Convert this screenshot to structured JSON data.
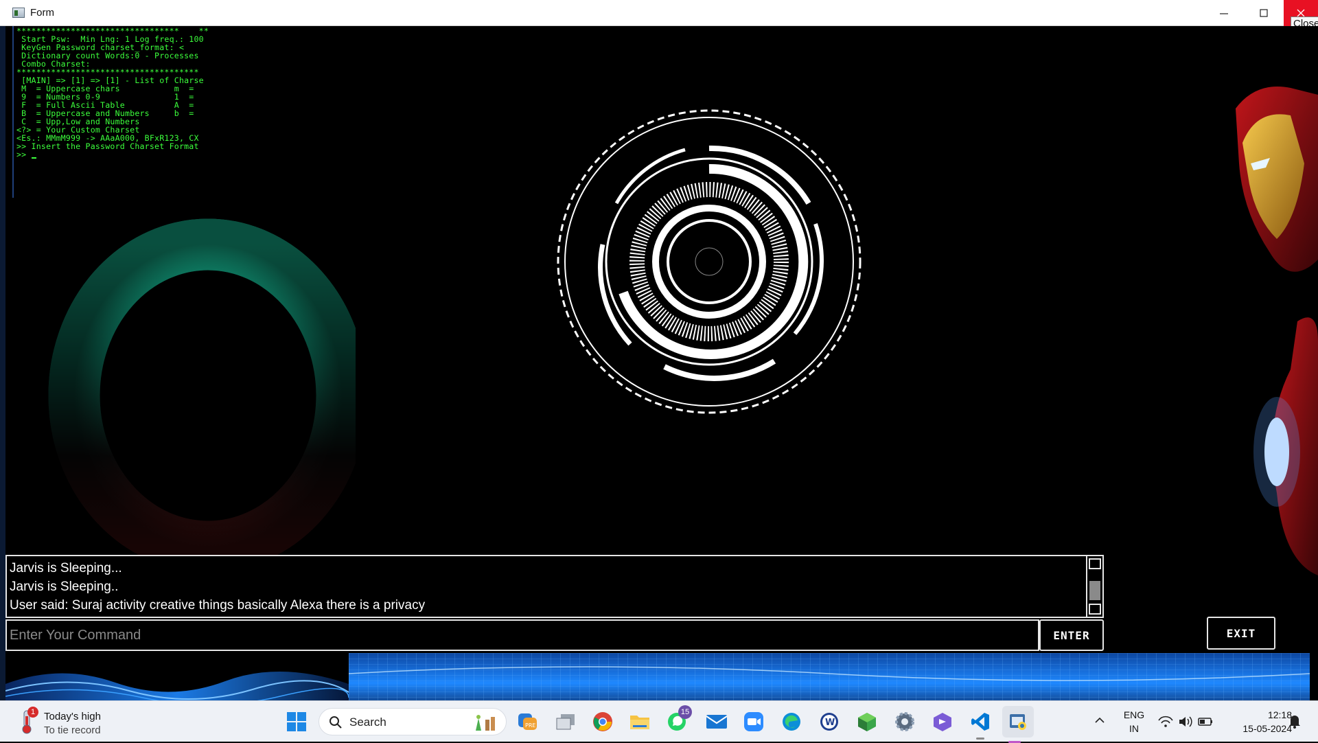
{
  "window": {
    "title": "Form",
    "close_tooltip": "Close"
  },
  "console": {
    "lines": [
      "*********************************    **",
      " Start Psw:  Min Lng: 1 Log freq.: 100",
      " KeyGen Password charset_format: <",
      " Dictionary count Words:0 - Processes",
      " Combo Charset:",
      "*************************************",
      " [MAIN] => [1] => [1] - List of Charse",
      " M  = Uppercase chars           m  =",
      " 9  = Numbers 0-9               1  =",
      " F  = Full Ascii Table          A  =",
      " B  = Uppercase and Numbers     b  =",
      " C  = Upp,Low and Numbers",
      "<?> = Your Custom Charset",
      "<Es.: MMmM999 -> AAaA000, BFxR123, CX",
      ">> Insert the Password Charset Format",
      ">> "
    ]
  },
  "log": {
    "lines": [
      "Jarvis is Sleeping...",
      "Jarvis is Sleeping..",
      "User said: Suraj activity creative things basically Alexa there is a privacy"
    ]
  },
  "command": {
    "placeholder": "Enter Your Command",
    "value": ""
  },
  "buttons": {
    "enter": "ENTER",
    "exit": "EXIT"
  },
  "taskbar": {
    "weather_title": "Today's high",
    "weather_sub": "To tie record",
    "weather_badge": "1",
    "search_label": "Search",
    "whatsapp_badge": "15",
    "lang_line1": "ENG",
    "lang_line2": "IN",
    "time": "12:18",
    "date": "15-05-2024",
    "apps": [
      "windows-start-icon",
      "copilot-pre-icon",
      "task-view-icon",
      "chrome-icon",
      "file-explorer-icon",
      "whatsapp-icon",
      "mail-icon",
      "zoom-icon",
      "edge-icon",
      "word-icon",
      "minecraft-icon",
      "settings-icon",
      "visual-studio-icon",
      "vscode-icon",
      "python-icon"
    ]
  },
  "colors": {
    "console_text": "#3cff3c",
    "accent_close": "#e81123",
    "ring_teal": "#13b38f",
    "hud_white": "#ffffff",
    "wave_blue": "#1e88ff"
  }
}
